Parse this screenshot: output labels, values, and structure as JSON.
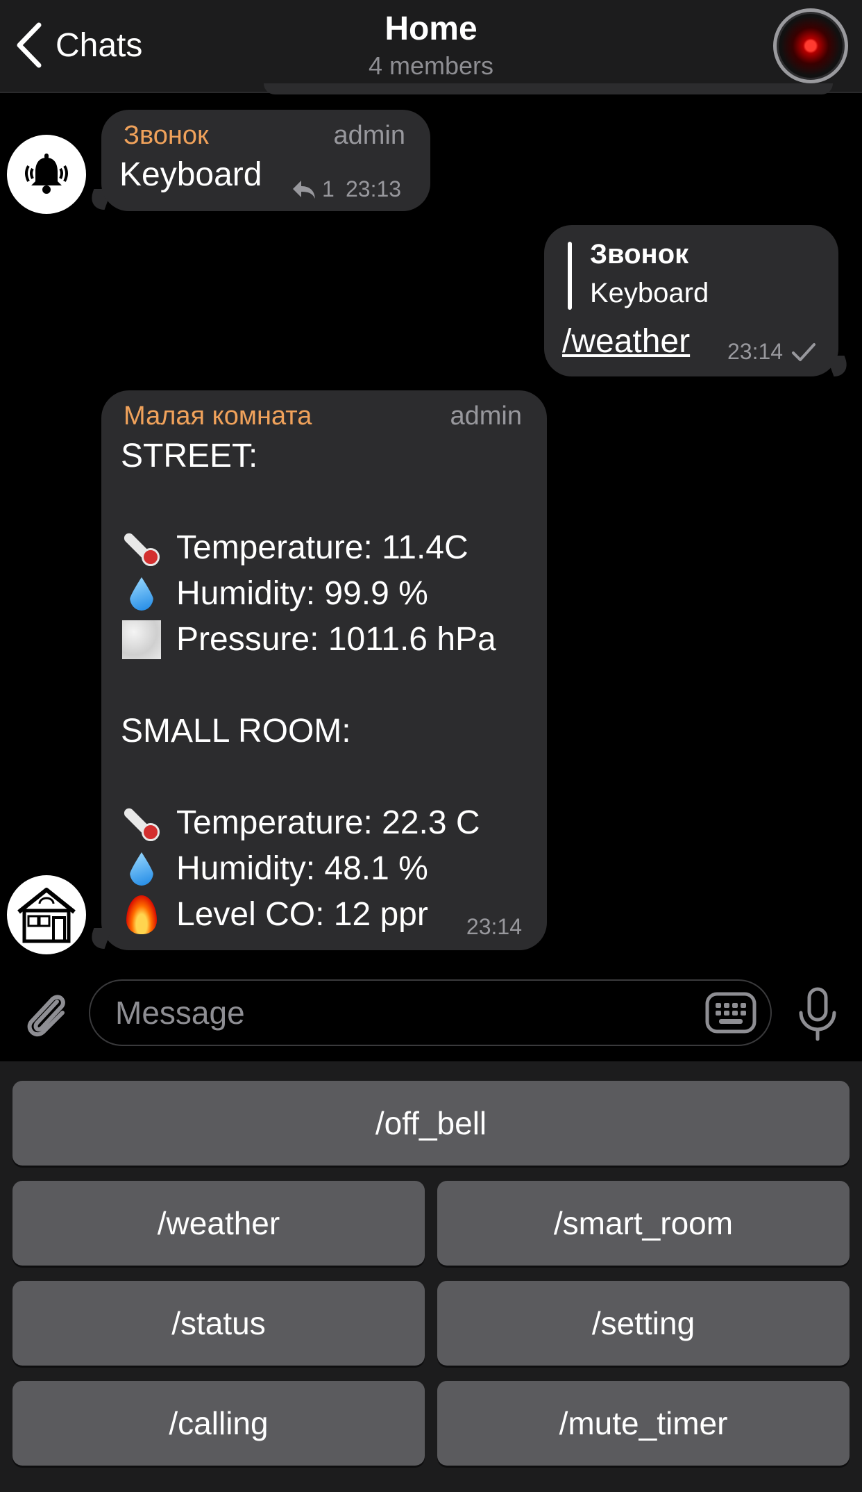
{
  "header": {
    "back_label": "Chats",
    "title": "Home",
    "subtitle": "4 members"
  },
  "messages": {
    "bell": {
      "sender": "Звонок",
      "role": "admin",
      "text": "Keyboard",
      "reply_count": "1",
      "time": "23:13"
    },
    "outgoing": {
      "quote_sender": "Звонок",
      "quote_text": "Keyboard",
      "text": "/weather",
      "time": "23:14"
    },
    "weather": {
      "sender": "Малая комната",
      "role": "admin",
      "time": "23:14",
      "lines": {
        "street_header": "STREET:",
        "street_temp": "Temperature: 11.4C",
        "street_hum": "Humidity: 99.9 %",
        "street_press": "Pressure: 1011.6 hPa",
        "room_header": "SMALL ROOM:",
        "room_temp": "Temperature: 22.3 C",
        "room_hum": "Humidity: 48.1 %",
        "room_co": "Level CO: 12 ppr"
      }
    }
  },
  "input": {
    "placeholder": "Message"
  },
  "keyboard": {
    "off_bell": "/off_bell",
    "weather": "/weather",
    "smart_room": "/smart_room",
    "status": "/status",
    "setting": "/setting",
    "calling": "/calling",
    "mute_timer": "/mute_timer"
  },
  "colors": {
    "accent_sender": "#f0a25b",
    "bubble": "#2c2c2e",
    "keyboard_button": "#5b5b5e"
  }
}
